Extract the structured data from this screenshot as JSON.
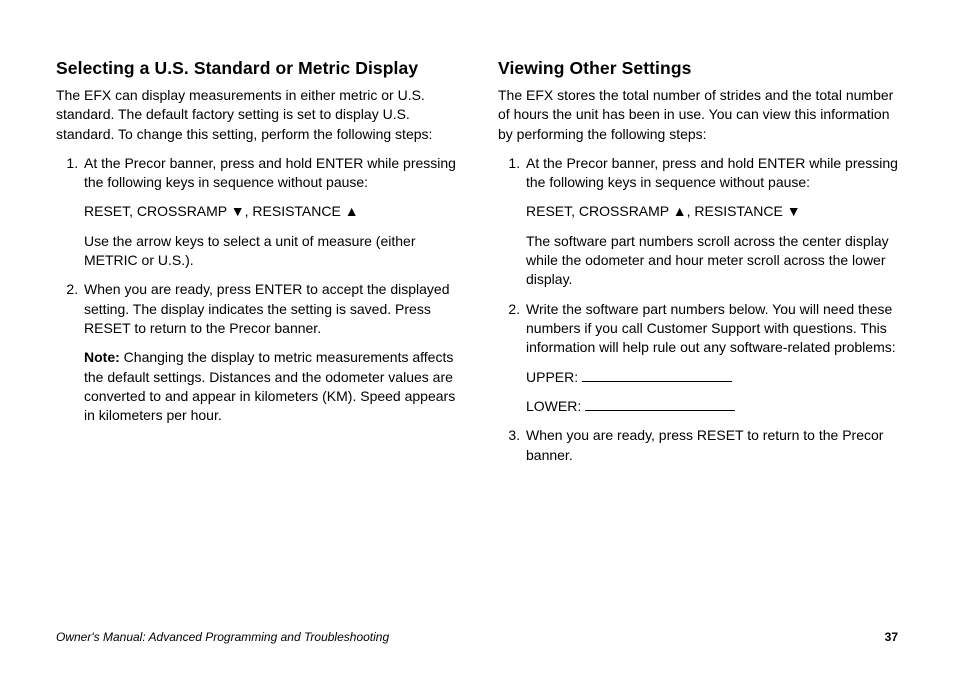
{
  "left": {
    "heading": "Selecting a U.S. Standard or Metric Display",
    "intro": "The EFX can display measurements in either metric or U.S. standard. The default factory setting is set to display U.S. standard. To change this setting, perform the following steps:",
    "step1_a": "At the Precor banner, press and hold ENTER while pressing the following keys in sequence without pause:",
    "step1_b": "RESET, CROSSRAMP ▼, RESISTANCE ▲",
    "step1_c": "Use the arrow keys to select a unit of measure (either METRIC or U.S.).",
    "step2_a": "When you are ready, press ENTER to accept the displayed setting. The display indicates the setting is saved. Press RESET to return to the Precor banner.",
    "note_label": "Note:",
    "note_body": " Changing the display to metric measurements affects the default settings. Distances and the odometer values are converted to and appear in kilometers (KM). Speed appears in kilometers per hour."
  },
  "right": {
    "heading": "Viewing Other Settings",
    "intro": "The EFX stores the total number of strides and the total number of hours the unit has been in use. You can view this information by performing the following steps:",
    "step1_a": "At the Precor banner, press and hold ENTER while pressing the following keys in sequence without pause:",
    "step1_b": "RESET, CROSSRAMP ▲, RESISTANCE ▼",
    "step1_c": "The software part numbers scroll across the center display while the odometer and hour meter scroll across the lower display.",
    "step2_a": "Write the software part numbers below. You will need these numbers if you call Customer Support with questions. This information will help rule out any software-related problems:",
    "upper_label": "UPPER:",
    "lower_label": "LOWER:",
    "step3": "When you are ready, press RESET to return to the Precor banner."
  },
  "footer": {
    "left": "Owner's Manual: Advanced Programming and Troubleshooting",
    "page": "37"
  }
}
